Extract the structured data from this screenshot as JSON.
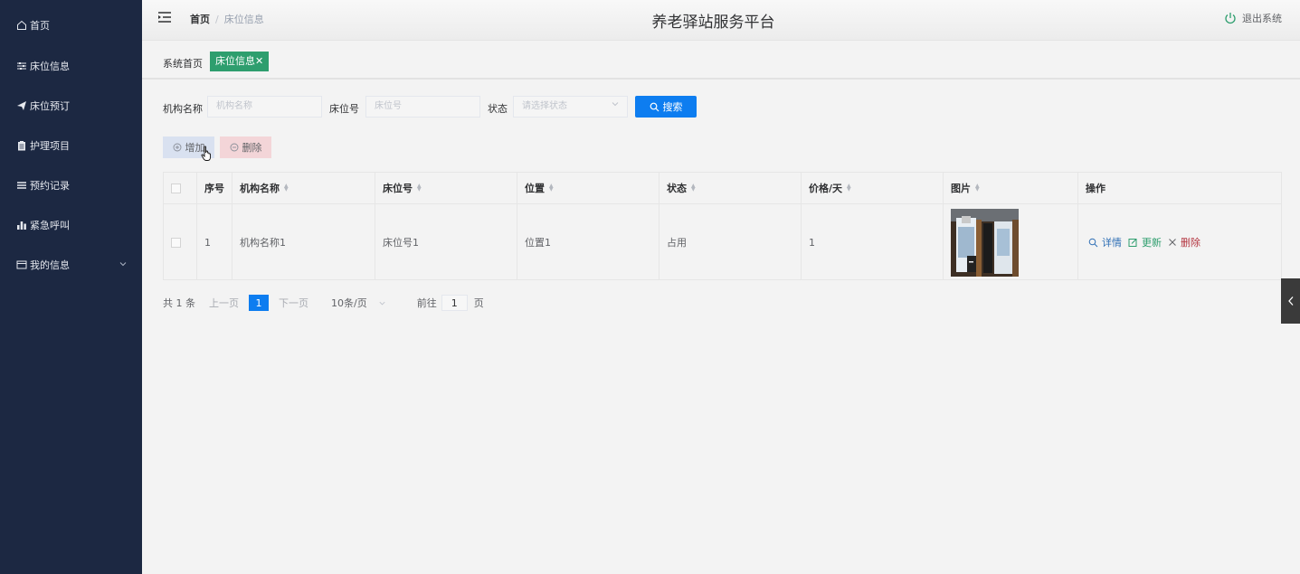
{
  "sidebar": {
    "items": [
      {
        "label": "首页",
        "icon": "home-icon"
      },
      {
        "label": "床位信息",
        "icon": "sliders-icon"
      },
      {
        "label": "床位预订",
        "icon": "paper-plane-icon"
      },
      {
        "label": "护理项目",
        "icon": "clipboard-icon"
      },
      {
        "label": "预约记录",
        "icon": "list-icon"
      },
      {
        "label": "紧急呼叫",
        "icon": "bar-chart-icon"
      },
      {
        "label": "我的信息",
        "icon": "id-card-icon"
      }
    ]
  },
  "header": {
    "breadcrumb_home": "首页",
    "breadcrumb_sep": "/",
    "breadcrumb_current": "床位信息",
    "site_title": "养老驿站服务平台",
    "logout_label": "退出系统"
  },
  "tags": {
    "home": "系统首页",
    "active": "床位信息",
    "close": "✕"
  },
  "search": {
    "org_label": "机构名称",
    "org_placeholder": "机构名称",
    "bed_label": "床位号",
    "bed_placeholder": "床位号",
    "status_label": "状态",
    "status_placeholder": "请选择状态",
    "search_button": "搜索"
  },
  "actions": {
    "add": "增加",
    "delete": "删除"
  },
  "table": {
    "headers": {
      "index": "序号",
      "org": "机构名称",
      "bed": "床位号",
      "location": "位置",
      "status": "状态",
      "price": "价格/天",
      "image": "图片",
      "ops": "操作"
    },
    "rows": [
      {
        "index": "1",
        "org": "机构名称1",
        "bed": "床位号1",
        "location": "位置1",
        "status": "占用",
        "price": "1"
      }
    ],
    "ops": {
      "detail": "详情",
      "update": "更新",
      "delete": "删除"
    }
  },
  "pagination": {
    "total": "共 1 条",
    "prev": "上一页",
    "current": "1",
    "next": "下一页",
    "page_size": "10条/页",
    "goto": "前往",
    "goto_value": "1",
    "page_unit": "页"
  },
  "colors": {
    "sidebar_bg": "#1c2842",
    "primary": "#0d7df0",
    "tag_active": "#2e9e6e",
    "op_detail": "#2f6fb5",
    "op_update": "#2e9e6e",
    "op_delete": "#b3343f"
  }
}
